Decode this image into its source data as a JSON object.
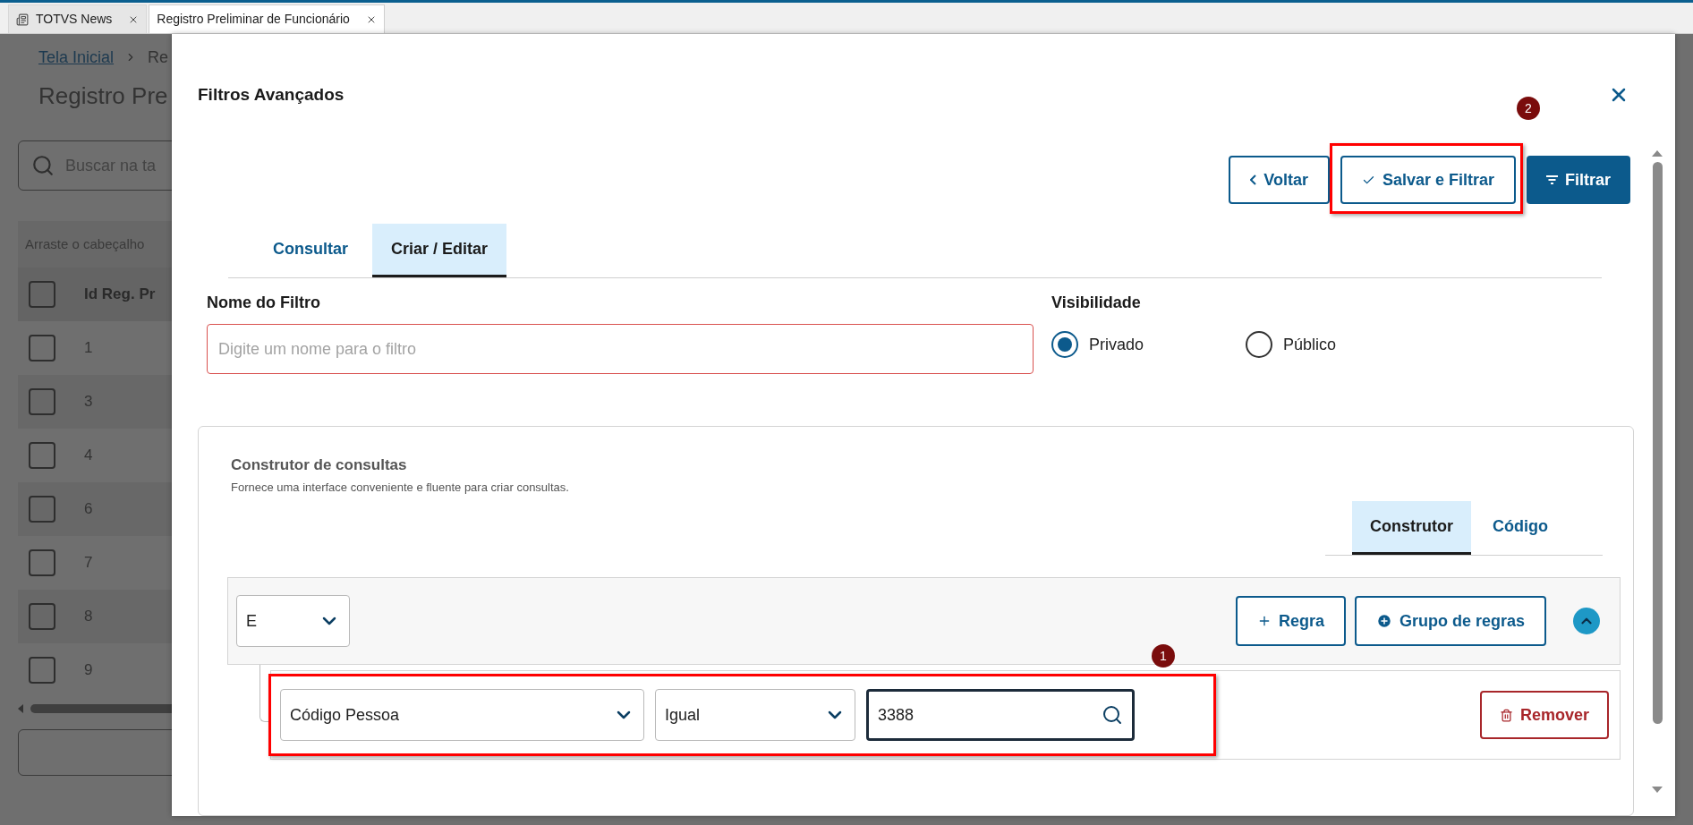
{
  "browser_tabs": [
    {
      "label": "TOTVS News",
      "selected": false
    },
    {
      "label": "Registro Preliminar de Funcionário",
      "selected": true
    }
  ],
  "background_page": {
    "breadcrumb": [
      "Tela Inicial",
      "Re"
    ],
    "title": "Registro Pre",
    "search": {
      "placeholder": "Buscar na ta"
    },
    "group_hint": "Arraste o cabeçalho",
    "table": {
      "columns": [
        "Id Reg. Pr"
      ],
      "header_checked": false,
      "rows": [
        {
          "id": "1",
          "checked": false
        },
        {
          "id": "3",
          "checked": false
        },
        {
          "id": "4",
          "checked": false
        },
        {
          "id": "6",
          "checked": false
        },
        {
          "id": "7",
          "checked": false
        },
        {
          "id": "8",
          "checked": false
        },
        {
          "id": "9",
          "checked": false
        }
      ]
    }
  },
  "dialog": {
    "title": "Filtros Avançados",
    "actions": [
      {
        "label": "Voltar",
        "kind": "back"
      },
      {
        "label": "Salvar e Filtrar",
        "kind": "save",
        "annotation": "2"
      },
      {
        "label": "Filtrar",
        "kind": "primary"
      }
    ],
    "tabs": [
      {
        "label": "Consultar",
        "selected": false
      },
      {
        "label": "Criar / Editar",
        "selected": true
      }
    ],
    "filter_name": {
      "label": "Nome do Filtro",
      "placeholder": "Digite um nome para o filtro",
      "invalid": true
    },
    "visibility": {
      "label": "Visibilidade",
      "options": [
        {
          "label": "Privado",
          "selected": true
        },
        {
          "label": "Público",
          "selected": false
        }
      ]
    },
    "query_builder": {
      "title": "Construtor de consultas",
      "description": "Fornece uma interface conveniente e fluente para criar consultas.",
      "tabs": [
        {
          "label": "Construtor",
          "selected": true
        },
        {
          "label": "Código",
          "selected": false
        }
      ],
      "group": {
        "operator": "E",
        "actions": [
          {
            "label": "Regra",
            "kind": "rule"
          },
          {
            "label": "Grupo de regras",
            "kind": "group"
          }
        ],
        "expanded": true,
        "rules": [
          {
            "field": "Código Pessoa",
            "condition": "Igual",
            "value": "3388",
            "focused": true,
            "annotation": "1",
            "remove_label": "Remover"
          }
        ]
      }
    }
  }
}
